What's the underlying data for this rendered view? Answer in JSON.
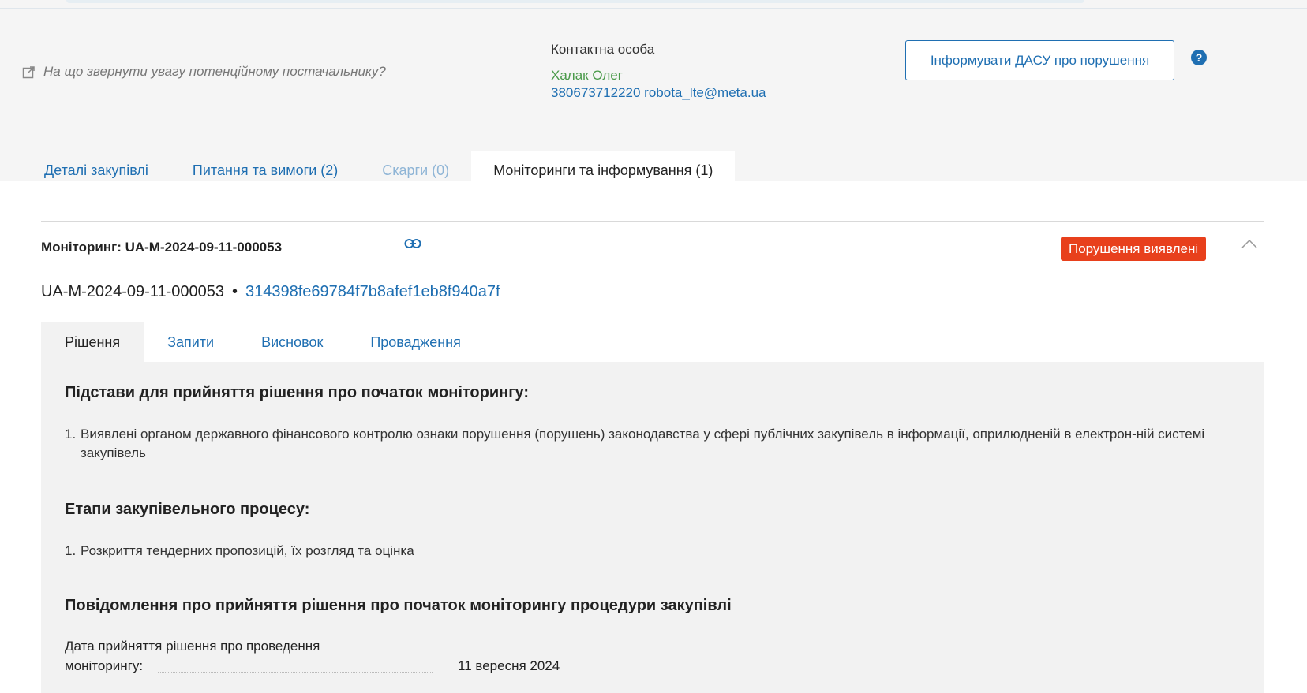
{
  "header": {
    "hint_text": "На що звернути увагу потенційному постачальнику?",
    "contact_label": "Контактна особа",
    "contact_name": "Халак Олег",
    "contact_details": "380673712220 robota_lte@meta.ua",
    "dasu_button_label": "Інформувати ДАСУ про порушення",
    "help_label": "?"
  },
  "tabs": [
    {
      "label": "Деталі закупівлі",
      "state": "normal"
    },
    {
      "label": "Питання та вимоги (2)",
      "state": "normal"
    },
    {
      "label": "Скарги (0)",
      "state": "disabled"
    },
    {
      "label": "Моніторинги та інформування (1)",
      "state": "active"
    }
  ],
  "monitoring": {
    "title": "Моніторинг: UA-M-2024-09-11-000053",
    "status": "Порушення виявлені",
    "status_color": "#e8401c",
    "id": "UA-M-2024-09-11-000053",
    "separator": "•",
    "hash": "314398fe69784f7b8afef1eb8f940a7f",
    "subtabs": [
      "Рішення",
      "Запити",
      "Висновок",
      "Провадження"
    ],
    "active_subtab": "Рішення"
  },
  "decision": {
    "grounds_heading": "Підстави для прийняття рішення про початок моніторингу:",
    "grounds_items": [
      {
        "num": "1.",
        "text": "Виявлені органом державного фінансового контролю ознаки порушення (порушень) законодавства у сфері публічних закупівель в інформації, оприлюдненій в електрон-ній системі закупівель"
      }
    ],
    "stages_heading": "Етапи закупівельного процесу:",
    "stages_items": [
      {
        "num": "1.",
        "text": "Розкриття тендерних пропозицій, їх розгляд та оцінка"
      }
    ],
    "notice_heading": "Повідомлення про прийняття рішення про початок моніторингу процедури закупівлі",
    "date_label_line1": "Дата прийняття рішення про проведення",
    "date_label_line2": "моніторингу:",
    "date_value": "11 вересня 2024"
  },
  "colors": {
    "link": "#1f6fb2",
    "contact_name": "#4a9a4a",
    "panel_bg": "#f2f2f2",
    "header_bg": "#f5f5f5"
  }
}
